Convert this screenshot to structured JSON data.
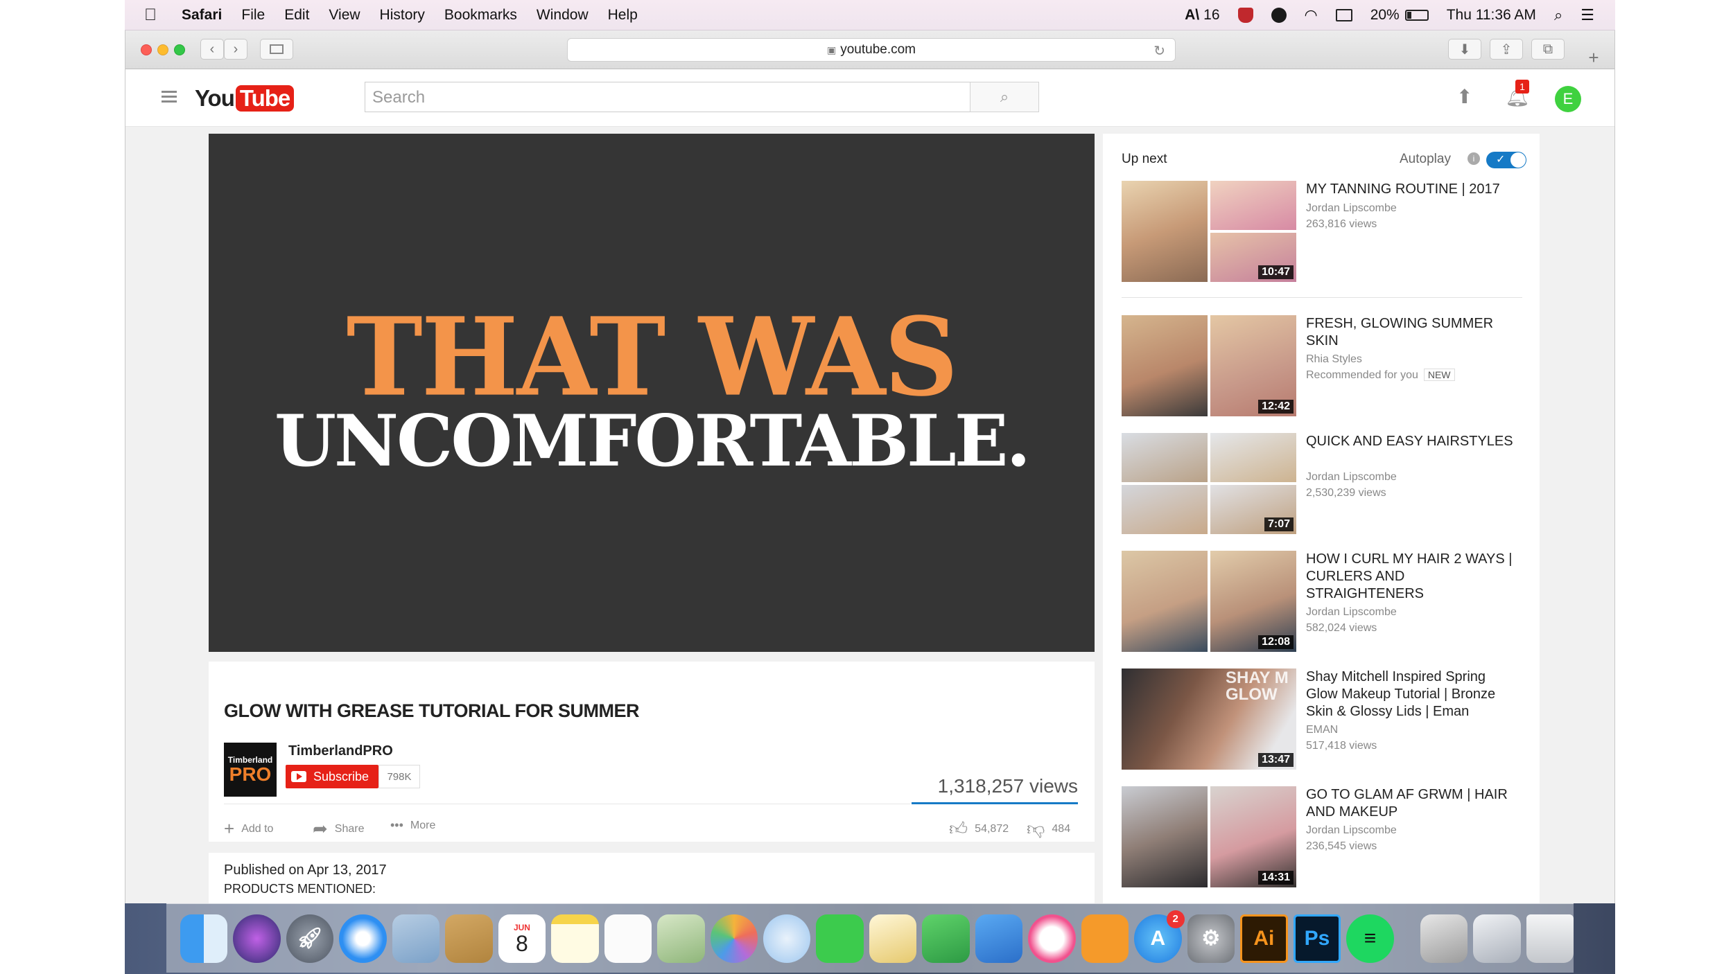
{
  "menubar": {
    "app": "Safari",
    "items": [
      "File",
      "Edit",
      "View",
      "History",
      "Bookmarks",
      "Window",
      "Help"
    ],
    "adobe_count": "16",
    "battery": "20%",
    "clock": "Thu 11:36 AM"
  },
  "browser": {
    "url": "youtube.com"
  },
  "youtube": {
    "logo_you": "You",
    "logo_tube": "Tube",
    "search_placeholder": "Search",
    "notification_count": "1",
    "avatar_letter": "E",
    "video": {
      "overlay_line1": "THAT WAS",
      "overlay_line2": "UNCOMFORTABLE.",
      "title": "GLOW WITH GREASE TUTORIAL FOR SUMMER",
      "channel": "TimberlandPRO",
      "channel_logo_top": "Timberland",
      "channel_logo_bottom": "PRO",
      "subscribe": "Subscribe",
      "subscribers": "798K",
      "views": "1,318,257 views",
      "add_to": "Add to",
      "share": "Share",
      "more": "More",
      "likes": "54,872",
      "dislikes": "484",
      "published": "Published on Apr 13, 2017",
      "products": "PRODUCTS MENTIONED:"
    },
    "sidebar": {
      "up_next": "Up next",
      "autoplay": "Autoplay",
      "videos": [
        {
          "title": "MY TANNING ROUTINE | 2017",
          "channel": "Jordan Lipscombe",
          "views": "263,816 views",
          "duration": "10:47"
        },
        {
          "title": "FRESH, GLOWING SUMMER SKIN",
          "channel": "Rhia Styles",
          "views": "Recommended for you",
          "badge": "NEW",
          "duration": "12:42"
        },
        {
          "title": "QUICK AND EASY HAIRSTYLES",
          "channel": "Jordan Lipscombe",
          "views": "2,530,239 views",
          "duration": "7:07"
        },
        {
          "title": "HOW I CURL MY HAIR 2 WAYS | CURLERS AND STRAIGHTENERS",
          "channel": "Jordan Lipscombe",
          "views": "582,024 views",
          "duration": "12:08"
        },
        {
          "title": "Shay Mitchell Inspired Spring Glow Makeup Tutorial | Bronze Skin & Glossy Lids | Eman",
          "channel": "EMAN",
          "views": "517,418 views",
          "duration": "13:47",
          "thumb_text": "SHAY M GLOW"
        },
        {
          "title": "GO TO GLAM AF GRWM | HAIR AND MAKEUP",
          "channel": "Jordan Lipscombe",
          "views": "236,545 views",
          "duration": "14:31"
        }
      ]
    }
  },
  "dock": {
    "calendar_month": "JUN",
    "calendar_day": "8",
    "appstore_badge": "2",
    "illustrator": "Ai",
    "photoshop": "Ps"
  },
  "colors": {
    "youtube_red": "#e62117",
    "overlay_orange": "#f3944a",
    "player_bg": "#353535",
    "link_blue": "#167ac6"
  }
}
